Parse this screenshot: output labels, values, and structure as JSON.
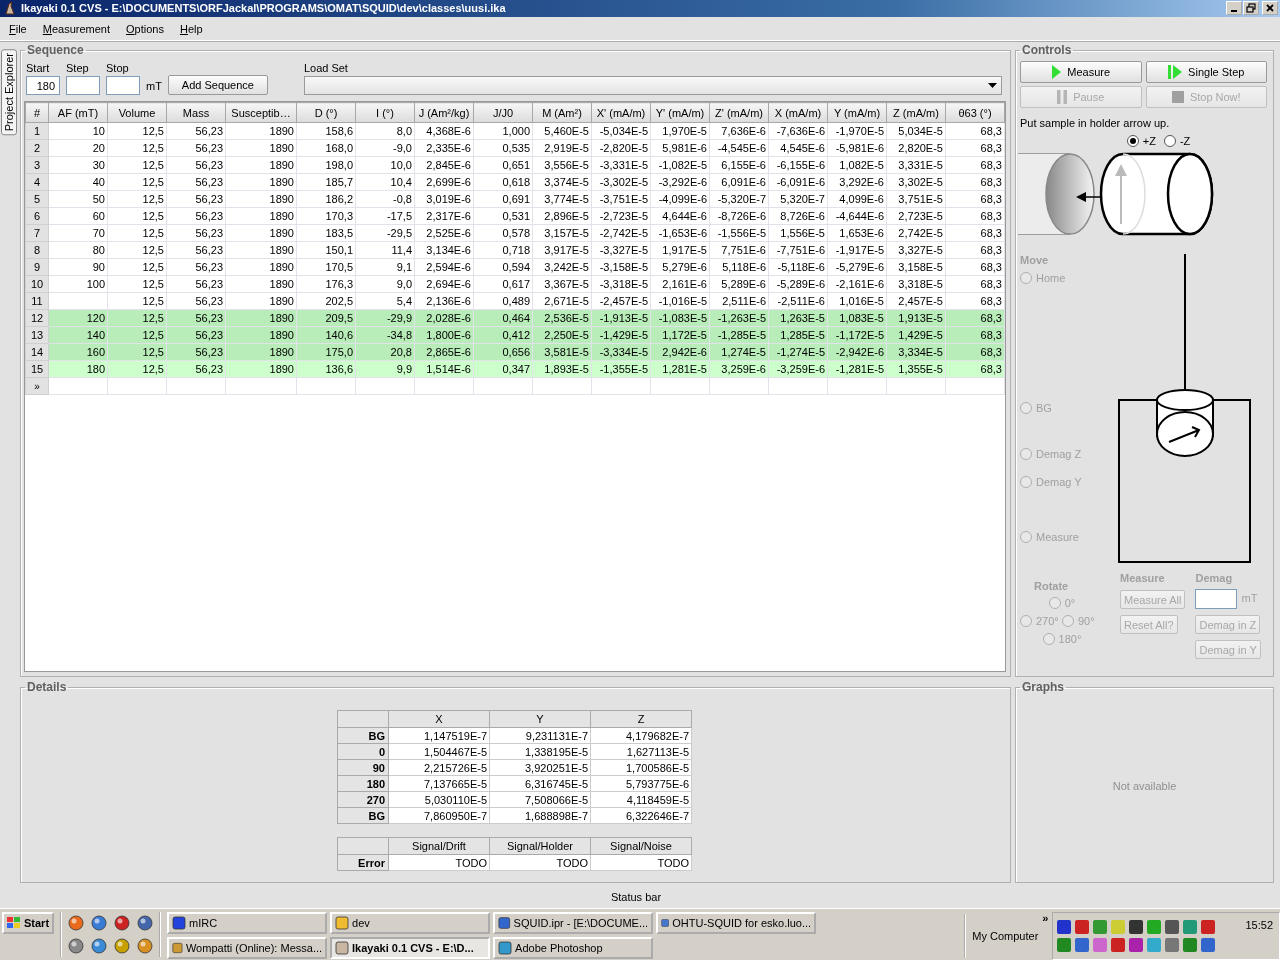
{
  "window": {
    "title": "Ikayaki 0.1 CVS - E:\\DOCUMENTS\\ORFJackal\\PROGRAMS\\OMAT\\SQUID\\dev\\classes\\uusi.ika"
  },
  "menu": [
    "File",
    "Measurement",
    "Options",
    "Help"
  ],
  "side_tab": "Project Explorer",
  "sequence": {
    "title": "Sequence",
    "start": {
      "label": "Start",
      "value": "180"
    },
    "step": {
      "label": "Step"
    },
    "stop": {
      "label": "Stop"
    },
    "unit": "mT",
    "add_button": "Add Sequence",
    "load_set": {
      "label": "Load Set"
    }
  },
  "table": {
    "columns": [
      "#",
      "AF (mT)",
      "Volume",
      "Mass",
      "Susceptib…",
      "D (°)",
      "I (°)",
      "J (Am²/kg)",
      "J/J0",
      "M (Am²)",
      "X' (mA/m)",
      "Y' (mA/m)",
      "Z' (mA/m)",
      "X (mA/m)",
      "Y (mA/m)",
      "Z (mA/m)",
      "θ63 (°)"
    ],
    "rows": [
      {
        "measured": false,
        "selected": false,
        "cells": [
          "1",
          "10",
          "12,5",
          "56,23",
          "1890",
          "158,6",
          "8,0",
          "4,368E-6",
          "1,000",
          "5,460E-5",
          "-5,034E-5",
          "1,970E-5",
          "7,636E-6",
          "-7,636E-6",
          "-1,970E-5",
          "5,034E-5",
          "68,3"
        ]
      },
      {
        "measured": false,
        "selected": false,
        "cells": [
          "2",
          "20",
          "12,5",
          "56,23",
          "1890",
          "168,0",
          "-9,0",
          "2,335E-6",
          "0,535",
          "2,919E-5",
          "-2,820E-5",
          "5,981E-6",
          "-4,545E-6",
          "4,545E-6",
          "-5,981E-6",
          "2,820E-5",
          "68,3"
        ]
      },
      {
        "measured": false,
        "selected": false,
        "cells": [
          "3",
          "30",
          "12,5",
          "56,23",
          "1890",
          "198,0",
          "10,0",
          "2,845E-6",
          "0,651",
          "3,556E-5",
          "-3,331E-5",
          "-1,082E-5",
          "6,155E-6",
          "-6,155E-6",
          "1,082E-5",
          "3,331E-5",
          "68,3"
        ]
      },
      {
        "measured": false,
        "selected": false,
        "cells": [
          "4",
          "40",
          "12,5",
          "56,23",
          "1890",
          "185,7",
          "10,4",
          "2,699E-6",
          "0,618",
          "3,374E-5",
          "-3,302E-5",
          "-3,292E-6",
          "6,091E-6",
          "-6,091E-6",
          "3,292E-6",
          "3,302E-5",
          "68,3"
        ]
      },
      {
        "measured": false,
        "selected": false,
        "cells": [
          "5",
          "50",
          "12,5",
          "56,23",
          "1890",
          "186,2",
          "-0,8",
          "3,019E-6",
          "0,691",
          "3,774E-5",
          "-3,751E-5",
          "-4,099E-6",
          "-5,320E-7",
          "5,320E-7",
          "4,099E-6",
          "3,751E-5",
          "68,3"
        ]
      },
      {
        "measured": false,
        "selected": false,
        "cells": [
          "6",
          "60",
          "12,5",
          "56,23",
          "1890",
          "170,3",
          "-17,5",
          "2,317E-6",
          "0,531",
          "2,896E-5",
          "-2,723E-5",
          "4,644E-6",
          "-8,726E-6",
          "8,726E-6",
          "-4,644E-6",
          "2,723E-5",
          "68,3"
        ]
      },
      {
        "measured": false,
        "selected": false,
        "cells": [
          "7",
          "70",
          "12,5",
          "56,23",
          "1890",
          "183,5",
          "-29,5",
          "2,525E-6",
          "0,578",
          "3,157E-5",
          "-2,742E-5",
          "-1,653E-6",
          "-1,556E-5",
          "1,556E-5",
          "1,653E-6",
          "2,742E-5",
          "68,3"
        ]
      },
      {
        "measured": false,
        "selected": false,
        "cells": [
          "8",
          "80",
          "12,5",
          "56,23",
          "1890",
          "150,1",
          "11,4",
          "3,134E-6",
          "0,718",
          "3,917E-5",
          "-3,327E-5",
          "1,917E-5",
          "7,751E-6",
          "-7,751E-6",
          "-1,917E-5",
          "3,327E-5",
          "68,3"
        ]
      },
      {
        "measured": false,
        "selected": false,
        "cells": [
          "9",
          "90",
          "12,5",
          "56,23",
          "1890",
          "170,5",
          "9,1",
          "2,594E-6",
          "0,594",
          "3,242E-5",
          "-3,158E-5",
          "5,279E-6",
          "5,118E-6",
          "-5,118E-6",
          "-5,279E-6",
          "3,158E-5",
          "68,3"
        ]
      },
      {
        "measured": false,
        "selected": false,
        "cells": [
          "10",
          "100",
          "12,5",
          "56,23",
          "1890",
          "176,3",
          "9,0",
          "2,694E-6",
          "0,617",
          "3,367E-5",
          "-3,318E-5",
          "2,161E-6",
          "5,289E-6",
          "-5,289E-6",
          "-2,161E-6",
          "3,318E-5",
          "68,3"
        ]
      },
      {
        "measured": false,
        "selected": false,
        "cells": [
          "11",
          null,
          "12,5",
          "56,23",
          "1890",
          "202,5",
          "5,4",
          "2,136E-6",
          "0,489",
          "2,671E-5",
          "-2,457E-5",
          "-1,016E-5",
          "2,511E-6",
          "-2,511E-6",
          "1,016E-5",
          "2,457E-5",
          "68,3"
        ]
      },
      {
        "measured": true,
        "selected": false,
        "cells": [
          "12",
          "120",
          "12,5",
          "56,23",
          "1890",
          "209,5",
          "-29,9",
          "2,028E-6",
          "0,464",
          "2,536E-5",
          "-1,913E-5",
          "-1,083E-5",
          "-1,263E-5",
          "1,263E-5",
          "1,083E-5",
          "1,913E-5",
          "68,3"
        ]
      },
      {
        "measured": true,
        "selected": false,
        "cells": [
          "13",
          "140",
          "12,5",
          "56,23",
          "1890",
          "140,6",
          "-34,8",
          "1,800E-6",
          "0,412",
          "2,250E-5",
          "-1,429E-5",
          "1,172E-5",
          "-1,285E-5",
          "1,285E-5",
          "-1,172E-5",
          "1,429E-5",
          "68,3"
        ]
      },
      {
        "measured": true,
        "selected": false,
        "cells": [
          "14",
          "160",
          "12,5",
          "56,23",
          "1890",
          "175,0",
          "20,8",
          "2,865E-6",
          "0,656",
          "3,581E-5",
          "-3,334E-5",
          "2,942E-6",
          "1,274E-5",
          "-1,274E-5",
          "-2,942E-6",
          "3,334E-5",
          "68,3"
        ]
      },
      {
        "measured": true,
        "selected": true,
        "cells": [
          "15",
          "180",
          "12,5",
          "56,23",
          "1890",
          "136,6",
          "9,9",
          "1,514E-6",
          "0,347",
          "1,893E-5",
          "-1,355E-5",
          "1,281E-5",
          "3,259E-6",
          "-3,259E-6",
          "-1,281E-5",
          "1,355E-5",
          "68,3"
        ]
      }
    ],
    "new_row_marker": "»"
  },
  "controls": {
    "title": "Controls",
    "buttons": [
      {
        "label": "Measure",
        "kind": "play",
        "disabled": false
      },
      {
        "label": "Single Step",
        "kind": "step",
        "disabled": false
      },
      {
        "label": "Pause",
        "kind": "pause",
        "disabled": true
      },
      {
        "label": "Stop Now!",
        "kind": "stop",
        "disabled": true
      }
    ],
    "instruction": "Put sample in holder arrow up.",
    "orientation": [
      {
        "label": "+Z",
        "selected": true
      },
      {
        "label": "-Z",
        "selected": false
      }
    ],
    "move": {
      "title": "Move",
      "options": [
        {
          "label": "Home",
          "selected": false,
          "disabled": true
        },
        {
          "label": "BG",
          "selected": false,
          "disabled": true
        },
        {
          "label": "Demag Z",
          "selected": false,
          "disabled": true
        },
        {
          "label": "Demag Y",
          "selected": false,
          "disabled": true
        },
        {
          "label": "Measure",
          "selected": false,
          "disabled": true
        }
      ]
    },
    "rotate": {
      "title": "Rotate",
      "options": [
        {
          "label": "0°",
          "selected": false,
          "disabled": true
        },
        {
          "label": "270°",
          "selected": false,
          "disabled": true
        },
        {
          "label": "90°",
          "selected": false,
          "disabled": true
        },
        {
          "label": "180°",
          "selected": false,
          "disabled": true
        }
      ]
    },
    "measure": {
      "title": "Measure",
      "buttons": [
        {
          "label": "Measure All",
          "disabled": true
        },
        {
          "label": "Reset All?",
          "disabled": true
        }
      ]
    },
    "demag": {
      "title": "Demag",
      "unit": "mT",
      "buttons": [
        {
          "label": "Demag in Z",
          "disabled": true
        },
        {
          "label": "Demag in Y",
          "disabled": true
        }
      ]
    }
  },
  "details": {
    "title": "Details",
    "results": {
      "columns": [
        "X",
        "Y",
        "Z"
      ],
      "rows": [
        {
          "label": "BG",
          "values": [
            "1,147519E-7",
            "9,231131E-7",
            "4,179682E-7"
          ]
        },
        {
          "label": "0",
          "values": [
            "1,504467E-5",
            "1,338195E-5",
            "1,627113E-5"
          ]
        },
        {
          "label": "90",
          "values": [
            "2,215726E-5",
            "3,920251E-5",
            "1,700586E-5"
          ]
        },
        {
          "label": "180",
          "values": [
            "7,137665E-5",
            "6,316745E-5",
            "5,793775E-6"
          ]
        },
        {
          "label": "270",
          "values": [
            "5,030110E-5",
            "7,508066E-5",
            "4,118459E-5"
          ]
        },
        {
          "label": "BG",
          "values": [
            "7,860950E-7",
            "1,688898E-7",
            "6,322646E-7"
          ]
        }
      ]
    },
    "errors": {
      "columns": [
        "Signal/Drift",
        "Signal/Holder",
        "Signal/Noise"
      ],
      "rows": [
        {
          "label": "Error",
          "values": [
            "TODO",
            "TODO",
            "TODO"
          ]
        }
      ]
    }
  },
  "graphs": {
    "title": "Graphs",
    "message": "Not available"
  },
  "status_bar": "Status bar",
  "taskbar": {
    "start": "Start",
    "tasks": [
      {
        "label": "mIRC",
        "selected": false
      },
      {
        "label": "dev",
        "selected": false
      },
      {
        "label": "SQUID.ipr - [E:\\DOCUME...",
        "selected": false
      },
      {
        "label": "OHTU-SQUID for esko.luo...",
        "selected": false
      },
      {
        "label": "Wompatti (Online): Messa...",
        "selected": false
      },
      {
        "label": "Ikayaki 0.1 CVS - E:\\D...",
        "selected": true
      },
      {
        "label": "Adobe Photoshop",
        "selected": false
      }
    ],
    "toolbar": "My Computer",
    "expand": "»",
    "clock": "15:52"
  }
}
